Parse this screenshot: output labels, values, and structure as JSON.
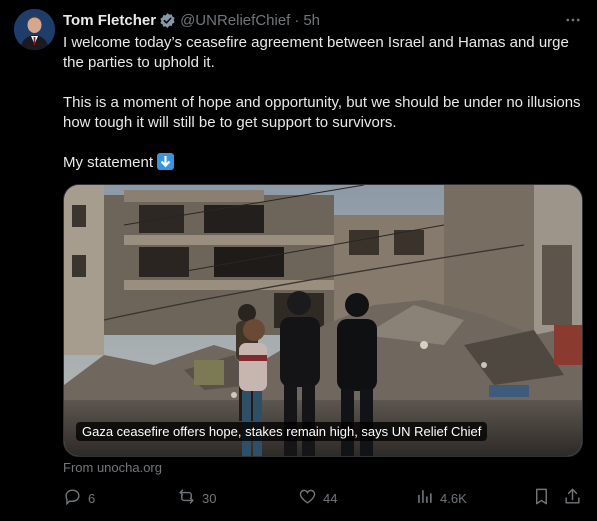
{
  "author": {
    "name": "Tom Fletcher",
    "handle": "@UNReliefChief",
    "separator": "·",
    "time": "5h",
    "verified_icon": "verified-badge-icon"
  },
  "text": {
    "para1": "I welcome today’s ceasefire agreement between Israel and Hamas and urge the parties to uphold it.",
    "para2": "This is a moment of hope and opportunity, but we should be under no illusions how tough it will still be to get support to survivors.",
    "para3": "My statement"
  },
  "card": {
    "caption": "Gaza ceasefire offers hope, stakes remain high, says UN Relief Chief",
    "source": "From unocha.org"
  },
  "actions": {
    "replies": "6",
    "reposts": "30",
    "likes": "44",
    "views": "4.6K"
  },
  "colors": {
    "background": "#000000",
    "text": "#e7e9ea",
    "muted": "#71767b",
    "verified": "#829aab"
  }
}
